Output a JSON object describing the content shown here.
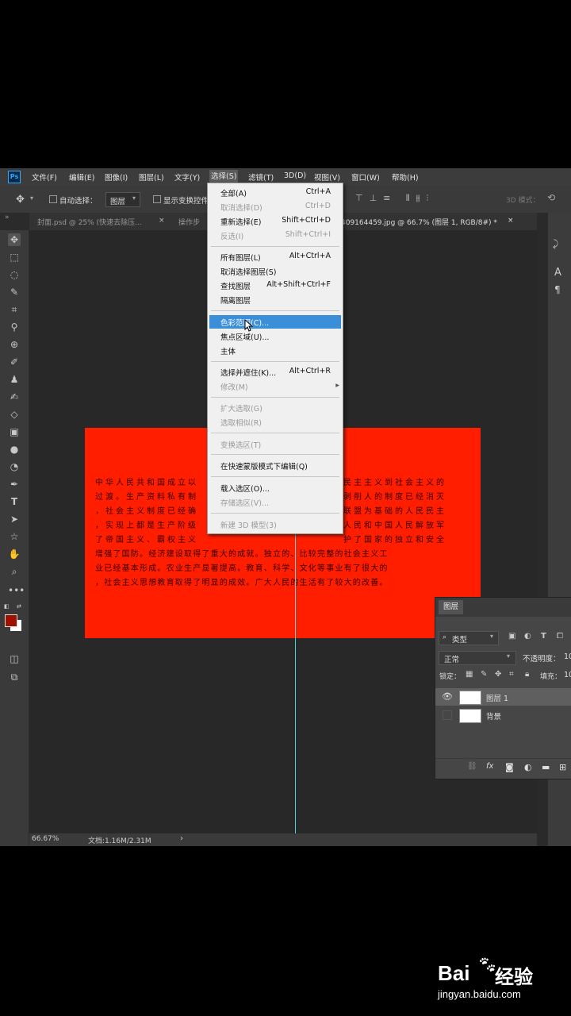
{
  "menubar": {
    "logo": "Ps",
    "items": [
      "文件(F)",
      "编辑(E)",
      "图像(I)",
      "图层(L)",
      "文字(Y)",
      "选择(S)",
      "滤镜(T)",
      "3D(D)",
      "视图(V)",
      "窗口(W)",
      "帮助(H)"
    ]
  },
  "options": {
    "auto_select_label": "自动选择：",
    "auto_select_value": "图层",
    "show_transform_label": "显示变换控件",
    "mode_3d": "3D 模式："
  },
  "tabs": {
    "tab1": "封面.psd @ 25% (快速去除压...",
    "tab1_close": "×",
    "tab2": "操作步",
    "tab3": "409164459.jpg @ 66.7% (图层 1, RGB/8#) *",
    "tab3_close": "×"
  },
  "document": {
    "lines_left": [
      "中华人民共和国成立以",
      "过渡。生产资料私有制",
      "，社会主义制度已经确",
      "，实现上都是生产阶级",
      "了帝国主义、霸权主义",
      "增强了国防。经济建设取得了重大的成就。独立的、比较完整的社会主义工",
      "业已经基本形成。农业生产显著提高。教育、科学、文化等事业有了很大的",
      "，社会主义思想教育取得了明显的成效。广大人民的生活有了较大的改善。"
    ],
    "lines_right": [
      "民主主义到社会主义的",
      "剥削人的制度已经消灭",
      "联盟为基础的人民民主",
      "人民和中国人民解放军",
      "护了国家的独立和安全"
    ]
  },
  "select_menu": {
    "items": [
      {
        "label": "全部(A)",
        "shortcut": "Ctrl+A",
        "disabled": false
      },
      {
        "label": "取消选择(D)",
        "shortcut": "Ctrl+D",
        "disabled": true
      },
      {
        "label": "重新选择(E)",
        "shortcut": "Shift+Ctrl+D",
        "disabled": false
      },
      {
        "label": "反选(I)",
        "shortcut": "Shift+Ctrl+I",
        "disabled": true
      },
      {
        "label": "所有图层(L)",
        "shortcut": "Alt+Ctrl+A",
        "disabled": false
      },
      {
        "label": "取消选择图层(S)",
        "shortcut": "",
        "disabled": false
      },
      {
        "label": "查找图层",
        "shortcut": "Alt+Shift+Ctrl+F",
        "disabled": false
      },
      {
        "label": "隔离图层",
        "shortcut": "",
        "disabled": false
      },
      {
        "label": "色彩范围(C)...",
        "shortcut": "",
        "disabled": false
      },
      {
        "label": "焦点区域(U)...",
        "shortcut": "",
        "disabled": false
      },
      {
        "label": "主体",
        "shortcut": "",
        "disabled": false
      },
      {
        "label": "选择并遮住(K)...",
        "shortcut": "Alt+Ctrl+R",
        "disabled": false
      },
      {
        "label": "修改(M)",
        "shortcut": "",
        "disabled": true
      },
      {
        "label": "扩大选取(G)",
        "shortcut": "",
        "disabled": true
      },
      {
        "label": "选取相似(R)",
        "shortcut": "",
        "disabled": true
      },
      {
        "label": "变换选区(T)",
        "shortcut": "",
        "disabled": true
      },
      {
        "label": "在快速蒙版模式下编辑(Q)",
        "shortcut": "",
        "disabled": false
      },
      {
        "label": "载入选区(O)...",
        "shortcut": "",
        "disabled": false
      },
      {
        "label": "存储选区(V)...",
        "shortcut": "",
        "disabled": true
      },
      {
        "label": "新建 3D 模型(3)",
        "shortcut": "",
        "disabled": true
      }
    ],
    "submenu_arrow": "▸"
  },
  "layers_panel": {
    "title": "图层",
    "filter_value": "类型",
    "blend_mode": "正常",
    "opacity_label": "不透明度：",
    "opacity_value": "10",
    "lock_label": "锁定：",
    "fill_label": "填充：",
    "fill_value": "10",
    "layers": [
      {
        "name": "图层 1",
        "visible": true,
        "selected": true
      },
      {
        "name": "背景",
        "visible": false,
        "selected": false
      }
    ],
    "footer_icons": [
      "link-icon",
      "fx-icon",
      "mask-icon",
      "adjustment-icon",
      "folder-icon",
      "new-layer-icon"
    ],
    "fx_label": "fx"
  },
  "status": {
    "zoom": "66.67%",
    "doc_info": "文档:1.16M/2.31M",
    "arrow": "›"
  },
  "watermark": {
    "brand_bai": "Bai",
    "brand_du": "du",
    "brand_cn": "经验",
    "url": "jingyan.baidu.com"
  },
  "colors": {
    "doc_red": "#ff1e00",
    "highlight": "#3b8fd9",
    "foreground_swatch": "#a01000"
  }
}
